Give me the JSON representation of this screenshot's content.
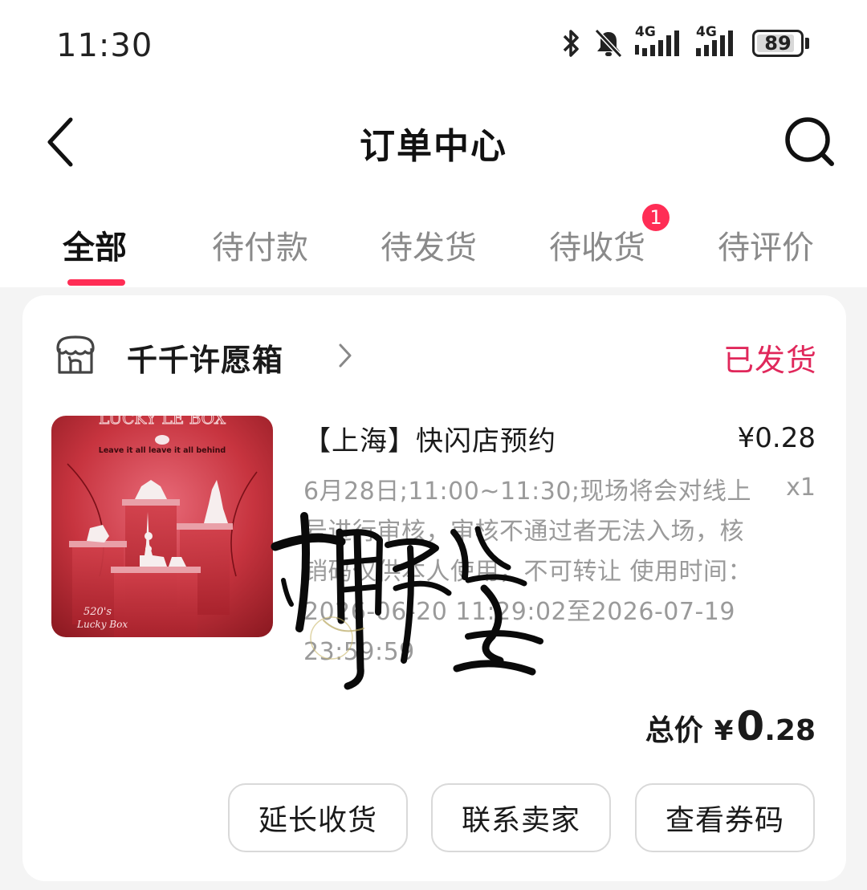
{
  "status_bar": {
    "time": "11:30",
    "network_1": "4G",
    "network_2": "4G",
    "battery": "89",
    "battery_level": 0.89,
    "icons": [
      "bluetooth-icon",
      "mute-bell-icon",
      "signal-icon",
      "signal-icon",
      "battery-icon"
    ]
  },
  "header": {
    "title": "订单中心",
    "back_icon": "chevron-left-icon",
    "search_icon": "search-icon"
  },
  "tabs": [
    {
      "label": "全部",
      "active": true
    },
    {
      "label": "待付款",
      "active": false
    },
    {
      "label": "待发货",
      "active": false
    },
    {
      "label": "待收货",
      "active": false,
      "badge": "1"
    },
    {
      "label": "待评价",
      "active": false
    }
  ],
  "order": {
    "shop": {
      "name": "千千许愿箱",
      "icon": "shop-icon"
    },
    "status": "已发货",
    "product": {
      "name": "【上海】快闪店预约",
      "price": "¥0.28",
      "quantity": "x1",
      "description": "6月28日;11:00~11:30;现场将会对线上号进行审核，审核不通过者无法入场，核销码仅供本人使用，不可转让 使用时间：2026-06-20 11:29:02至2026-07-19 23:59:59",
      "image_text": {
        "top": "LUCKY LE BOX",
        "line": "Leave it all leave it all behind",
        "brand_1": "520's",
        "brand_2": "Lucky Box"
      }
    },
    "total": {
      "label": "总价",
      "currency": "¥",
      "integer": "0",
      "decimal": ".28"
    },
    "actions": [
      "延长收货",
      "联系卖家",
      "查看券码"
    ]
  },
  "colors": {
    "accent": "#ff2d55",
    "status": "#e0285b",
    "muted": "#9a9a9a",
    "background": "#f4f4f4"
  }
}
